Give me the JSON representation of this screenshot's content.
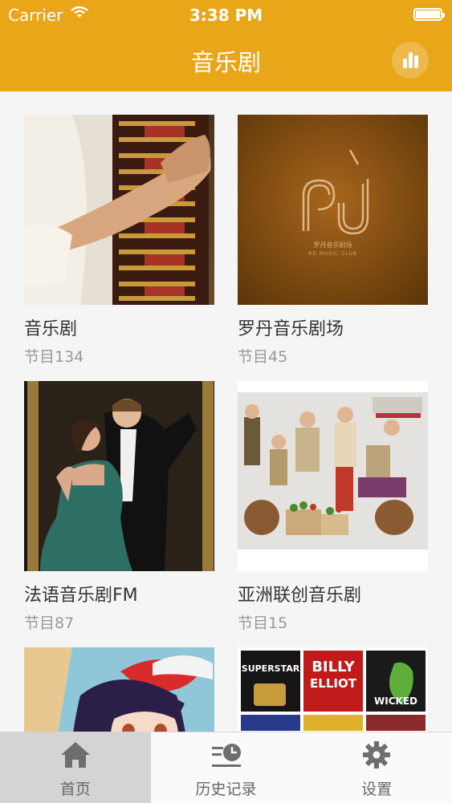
{
  "status_bar": {
    "carrier": "Carrier",
    "time": "3:38 PM"
  },
  "header": {
    "title": "音乐剧"
  },
  "cards": [
    {
      "title": "音乐剧",
      "subtitle": "节目134"
    },
    {
      "title": "罗丹音乐剧场",
      "subtitle": "节目45"
    },
    {
      "title": "法语音乐剧FM",
      "subtitle": "节目87"
    },
    {
      "title": "亚洲联创音乐剧",
      "subtitle": "节目15"
    }
  ],
  "thumb_text": {
    "rodan_cn": "罗丹音乐剧场",
    "rodan_en": "RD MUSIC CLUB",
    "superstar": "SUPERSTAR",
    "billy": "BILLY",
    "elliot": "ELLIOT",
    "wicked": "WICKED"
  },
  "tabbar": {
    "items": [
      {
        "label": "首页",
        "icon": "home-icon",
        "active": true
      },
      {
        "label": "历史记录",
        "icon": "history-icon",
        "active": false
      },
      {
        "label": "设置",
        "icon": "gear-icon",
        "active": false
      }
    ]
  },
  "colors": {
    "accent": "#e8a618",
    "tab_active_bg": "#d4d4d4"
  }
}
